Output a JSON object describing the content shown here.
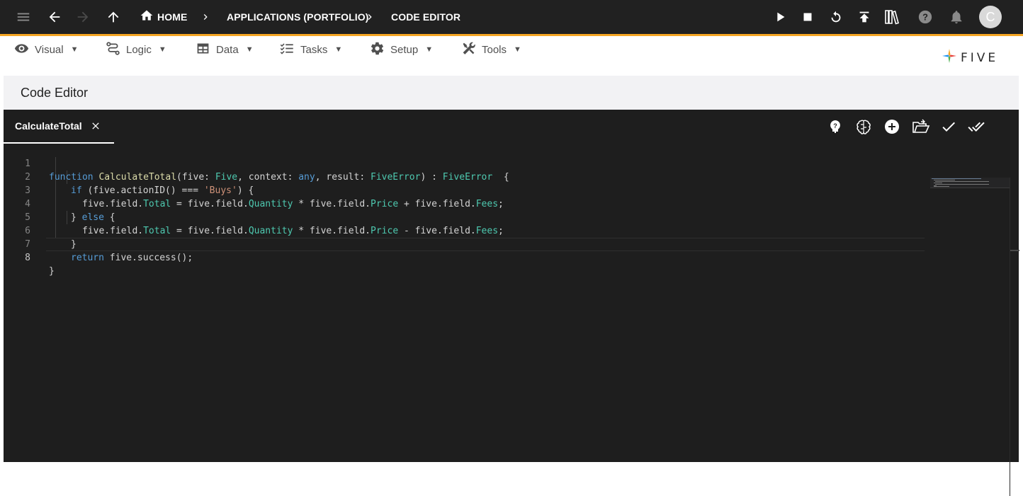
{
  "topbar": {
    "breadcrumbs": [
      "HOME",
      "APPLICATIONS (PORTFOLIO)",
      "CODE EDITOR"
    ],
    "avatar_initial": "C",
    "accent_color": "#f5a623",
    "bg_color": "#212121"
  },
  "menu": {
    "items": [
      {
        "label": "Visual",
        "icon": "eye-icon"
      },
      {
        "label": "Logic",
        "icon": "logic-flow-icon"
      },
      {
        "label": "Data",
        "icon": "table-icon"
      },
      {
        "label": "Tasks",
        "icon": "checklist-icon"
      },
      {
        "label": "Setup",
        "icon": "gear-icon"
      },
      {
        "label": "Tools",
        "icon": "tools-icon"
      }
    ],
    "caret": "▼"
  },
  "logo": {
    "text": "FIVE"
  },
  "page": {
    "title": "Code Editor"
  },
  "editor": {
    "tab_label": "CalculateTotal",
    "line_numbers": [
      "1",
      "2",
      "3",
      "4",
      "5",
      "6",
      "7",
      "8"
    ],
    "active_line": "8",
    "toolbar_icons": [
      "help-bulb-icon",
      "brain-icon",
      "add-circle-icon",
      "open-folder-icon",
      "check-icon",
      "double-check-icon"
    ],
    "code": {
      "l1": {
        "t1": "function",
        "t2": "CalculateTotal",
        "t3": "(five: ",
        "t4": "Five",
        "t5": ", context: ",
        "t6": "any",
        "t7": ", result: ",
        "t8": "FiveError",
        "t9": ") : ",
        "t10": "FiveError",
        "t11": "  {"
      },
      "l2": {
        "t1": "if",
        "t2": " (five.actionID() === ",
        "t3": "'Buys'",
        "t4": ") {"
      },
      "l3": {
        "t1": "five.field.",
        "t2": "Total",
        "t3": " = five.field.",
        "t4": "Quantity",
        "t5": " * five.field.",
        "t6": "Price",
        "t7": " + five.field.",
        "t8": "Fees",
        "t9": ";"
      },
      "l4": {
        "t1": "} ",
        "t2": "else",
        "t3": " {"
      },
      "l5": {
        "t1": "five.field.",
        "t2": "Total",
        "t3": " = five.field.",
        "t4": "Quantity",
        "t5": " * five.field.",
        "t6": "Price",
        "t7": " - five.field.",
        "t8": "Fees",
        "t9": ";"
      },
      "l6": {
        "t1": "}"
      },
      "l7": {
        "t1": "return",
        "t2": " five.success();"
      },
      "l8": {
        "t1": "}"
      }
    }
  }
}
